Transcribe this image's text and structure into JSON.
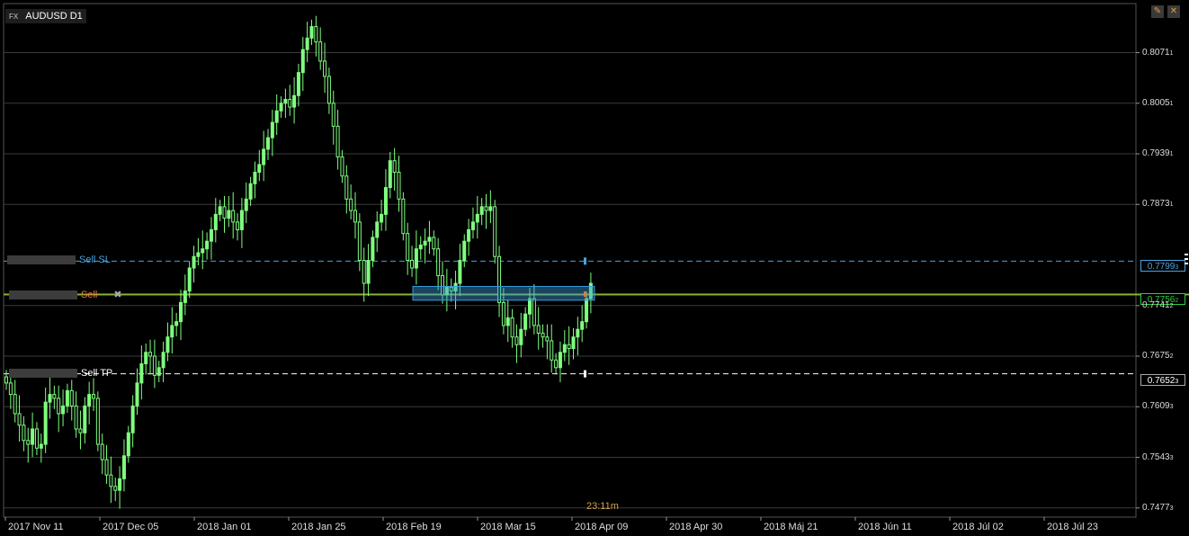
{
  "symbol_badge": {
    "market": "FX",
    "symbol": "AUDUSD D1"
  },
  "buttons": {
    "edit_icon": "pencil-icon",
    "close_icon": "close-icon"
  },
  "y_axis": {
    "ticks": [
      "0.8071",
      "0.8005",
      "0.7939",
      "0.7873",
      "0.7741",
      "0.7675",
      "0.7609",
      "0.7543",
      "0.7477"
    ],
    "tick_suffix": [
      "1",
      "1",
      "1",
      "1",
      "2",
      "2",
      "3",
      "3",
      "3"
    ]
  },
  "x_axis": {
    "ticks": [
      "2017 Nov 11",
      "2017 Dec 05",
      "2018 Jan 01",
      "2018 Jan 25",
      "2018 Feb 19",
      "2018 Mar 15",
      "2018 Apr 09",
      "2018 Apr 30",
      "2018 Máj 21",
      "2018 Jún 11",
      "2018 Júl 02",
      "2018 Júl 23"
    ]
  },
  "orders": {
    "sl": {
      "label": "Sell  SL",
      "price": "0.7799",
      "price_suffix": "3",
      "color": "#4aa3df"
    },
    "entry": {
      "label": "Sell",
      "price": "0.7756",
      "price_suffix": "2",
      "color": "#e07a3a"
    },
    "tp": {
      "label": "Sell  TP",
      "price": "0.7652",
      "price_suffix": "3",
      "color": "#ffffff"
    }
  },
  "timer": "23:11m",
  "colors": {
    "candle": "#7fff7f",
    "grid": "#3a3a3a",
    "current_price": "#2ecc40",
    "entry_line": "#e0a030",
    "zone": "#3a9ad9"
  },
  "chart_data": {
    "type": "candlestick",
    "ylim": [
      0.7465,
      0.8135
    ],
    "x_range": [
      "2017-11-11",
      "2018-08-01"
    ],
    "grid": true,
    "closes": [
      0.764,
      0.7625,
      0.76,
      0.7585,
      0.7565,
      0.756,
      0.758,
      0.7555,
      0.756,
      0.7615,
      0.7625,
      0.762,
      0.76,
      0.761,
      0.763,
      0.761,
      0.758,
      0.7575,
      0.761,
      0.7625,
      0.762,
      0.756,
      0.754,
      0.752,
      0.7505,
      0.75,
      0.7515,
      0.7545,
      0.7575,
      0.761,
      0.764,
      0.7665,
      0.768,
      0.7675,
      0.765,
      0.766,
      0.768,
      0.77,
      0.7715,
      0.772,
      0.7745,
      0.776,
      0.779,
      0.7805,
      0.781,
      0.7815,
      0.7825,
      0.784,
      0.786,
      0.787,
      0.7855,
      0.7865,
      0.785,
      0.784,
      0.7865,
      0.788,
      0.79,
      0.7915,
      0.7925,
      0.7945,
      0.796,
      0.798,
      0.7995,
      0.8005,
      0.801,
      0.8,
      0.8015,
      0.8045,
      0.8075,
      0.809,
      0.8105,
      0.8085,
      0.806,
      0.804,
      0.8005,
      0.7975,
      0.7935,
      0.791,
      0.788,
      0.7865,
      0.785,
      0.78,
      0.777,
      0.78,
      0.783,
      0.785,
      0.786,
      0.7895,
      0.793,
      0.7915,
      0.788,
      0.7835,
      0.78,
      0.779,
      0.7815,
      0.782,
      0.7825,
      0.783,
      0.7815,
      0.778,
      0.7755,
      0.7765,
      0.776,
      0.777,
      0.78,
      0.7825,
      0.784,
      0.785,
      0.786,
      0.787,
      0.7865,
      0.787,
      0.7805,
      0.7745,
      0.7715,
      0.7725,
      0.77,
      0.769,
      0.771,
      0.773,
      0.775,
      0.7715,
      0.7705,
      0.77,
      0.7695,
      0.767,
      0.766,
      0.768,
      0.769,
      0.7685,
      0.77,
      0.771,
      0.772,
      0.775,
      0.777
    ]
  }
}
